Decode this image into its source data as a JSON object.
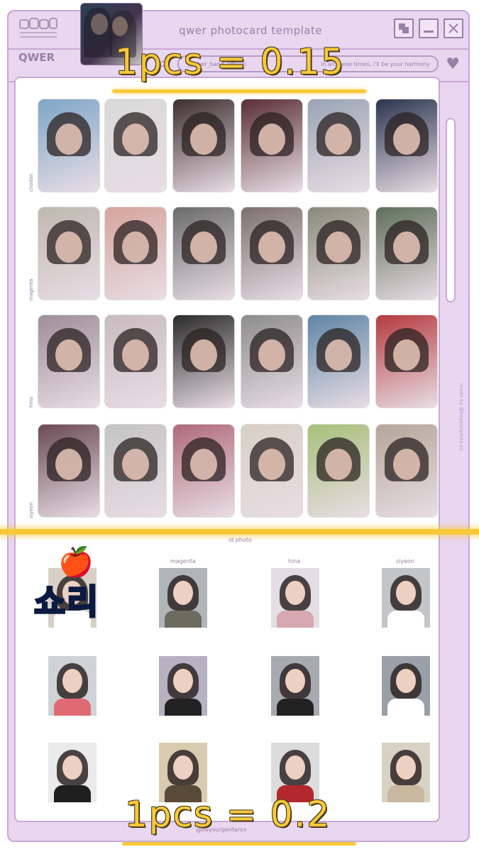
{
  "window": {
    "title": "qwer photocard template",
    "minimize_icon": "minimize-icon",
    "close_icon": "close-icon"
  },
  "addressbar": {
    "handle": "@qwer_band_official",
    "lyric": "in all these times, i'll be your harmony",
    "arrow": ">",
    "logo": "QWER"
  },
  "price_top": "1pcs = 0.15",
  "price_bottom": "1pcs = 0.2",
  "rows": [
    {
      "label": "chodan"
    },
    {
      "label": "magenta"
    },
    {
      "label": "hina"
    },
    {
      "label": "siyeon"
    }
  ],
  "id_photo": {
    "title": "id photo",
    "columns": [
      "",
      "magenta",
      "hina",
      "siyeon"
    ]
  },
  "sticker": {
    "apple": "🍎",
    "text": "쇼리"
  },
  "side_credit": "made by @beyourgenta.xx",
  "bottom_credit": "@beyourgentarxx",
  "colors": {
    "window_bg": "#e9d6ef",
    "border": "#c9a8d6",
    "accent_text": "#9a7fa8",
    "highlight": "#f7c93a",
    "sticker": "#38c8ee"
  }
}
